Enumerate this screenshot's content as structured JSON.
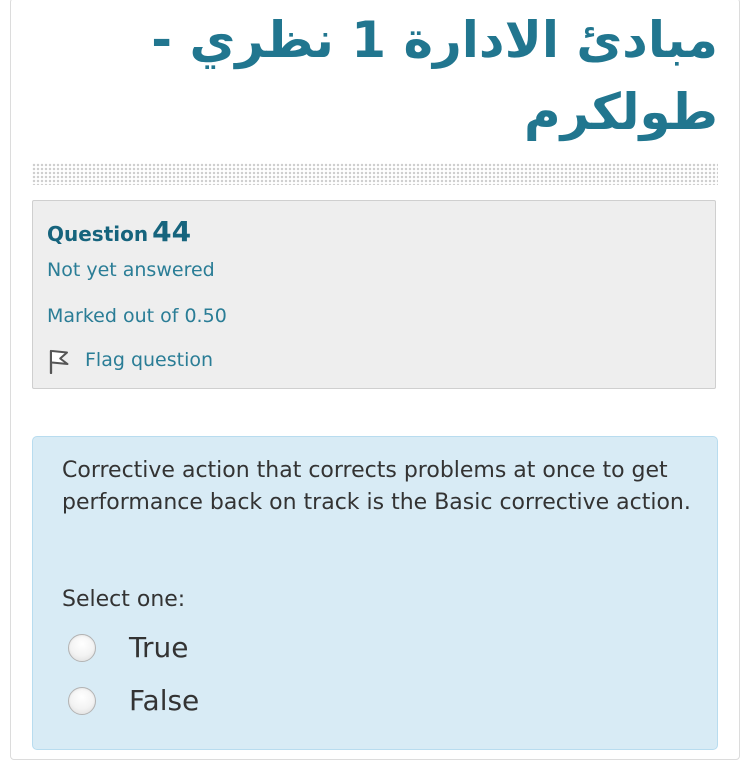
{
  "course": {
    "title": "مبادئ الادارة 1 نظري - طولكرم"
  },
  "question_info": {
    "question_word": "Question",
    "question_number": "44",
    "state": "Not yet answered",
    "grade": "Marked out of 0.50",
    "flag_label": "Flag question",
    "flag_icon": "flag-icon"
  },
  "question": {
    "text": "Corrective action that corrects problems at once to get performance back on track is the Basic corrective action.",
    "prompt": "Select one:",
    "options": [
      {
        "label": "True",
        "selected": false
      },
      {
        "label": "False",
        "selected": false
      }
    ]
  },
  "colors": {
    "title": "#21768f",
    "info_text": "#2a7d96",
    "question_background": "#d8ebf5",
    "info_background": "#eeeeee"
  }
}
